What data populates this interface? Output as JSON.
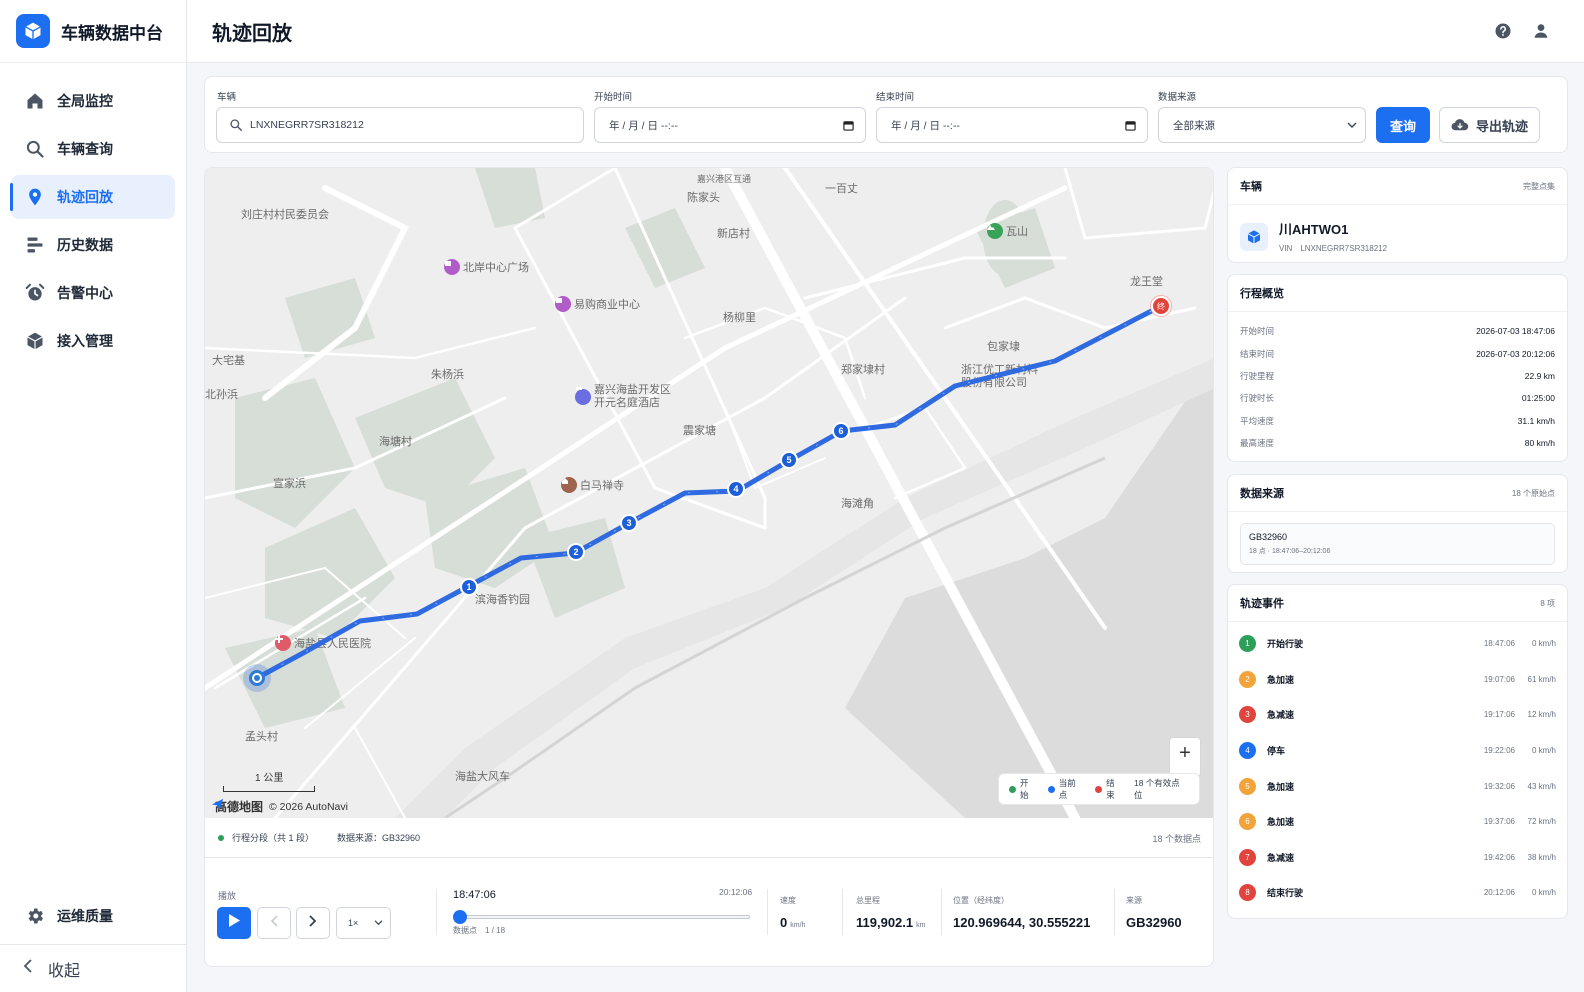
{
  "app": {
    "title": "车辆数据中台"
  },
  "colors": {
    "accent": "#1d6ff2",
    "start": "#2e9e5b",
    "end": "#e0443c",
    "orange": "#f2a33a"
  },
  "sidebar": {
    "items": [
      {
        "label": "全局监控",
        "icon": "home-icon",
        "active": false
      },
      {
        "label": "车辆查询",
        "icon": "search-icon",
        "active": false
      },
      {
        "label": "轨迹回放",
        "icon": "location-pin-icon",
        "active": true
      },
      {
        "label": "历史数据",
        "icon": "bars-icon",
        "active": false
      },
      {
        "label": "告警中心",
        "icon": "alarm-clock-icon",
        "active": false
      },
      {
        "label": "接入管理",
        "icon": "cube-icon",
        "active": false
      }
    ],
    "bottom_item": {
      "label": "运维质量",
      "icon": "gear-icon"
    },
    "collapse_label": "收起"
  },
  "header": {
    "title": "轨迹回放"
  },
  "filters": {
    "vehicle_label": "车辆",
    "vehicle_value": "LNXNEGRR7SR318212",
    "start_label": "开始时间",
    "start_placeholder": "年 / 月 / 日  --:--",
    "end_label": "结束时间",
    "end_placeholder": "年 / 月 / 日  --:--",
    "source_label": "数据来源",
    "source_value": "全部来源",
    "query_label": "查询",
    "export_label": "导出轨迹"
  },
  "map": {
    "labels": [
      "刘庄村村民委员会",
      "陈家头",
      "嘉兴港区互通",
      "一百丈",
      "新店村",
      "大宅基",
      "北孙浜",
      "朱杨浜",
      "杨柳里",
      "郑家埭村",
      "包家埭",
      "龙王堂",
      "海塘村",
      "宣家浜",
      "震家塘",
      "海滩角",
      "滨海香钓园",
      "孟头村",
      "海盐大风车"
    ],
    "pois": [
      {
        "name": "北岸中心广场",
        "color": "#b15dc9"
      },
      {
        "name": "易购商业中心",
        "color": "#b15dc9"
      },
      {
        "name": "嘉兴海盐开发区\n开元名庭酒店",
        "color": "#6a6ee0"
      },
      {
        "name": "白马禅寺",
        "color": "#a0634d"
      },
      {
        "name": "瓦山",
        "color": "#3aa35a"
      },
      {
        "name": "海盐县人民医院",
        "color": "#e05b6a"
      },
      {
        "name": "浙江优工新材料\n股份有限公司",
        "color": "#888888"
      }
    ],
    "markers": [
      "1",
      "2",
      "3",
      "4",
      "5",
      "6"
    ],
    "end_marker": "终",
    "scale_label": "1 公里",
    "attribution_logo": "高德地图",
    "attribution": "© 2026 AutoNavi",
    "zoom_in": "+",
    "legend": {
      "start": "开始",
      "current": "当前点",
      "end": "结束",
      "count": "18 个有效点位"
    }
  },
  "segment": {
    "label": "行程分段（共 1 段）",
    "source": "数据来源：GB32960",
    "count": "18 个数据点"
  },
  "playback": {
    "label": "播放",
    "speed": "1×",
    "current_time": "18:47:06",
    "end_time": "20:12:06",
    "point_label": "数据点　1 / 18",
    "progress": 0,
    "stats": [
      {
        "label": "速度",
        "value": "0",
        "unit": "km/h"
      },
      {
        "label": "总里程",
        "value": "119,902.1",
        "unit": "km"
      },
      {
        "label": "位置（经纬度）",
        "value": "120.969644, 30.555221",
        "unit": ""
      },
      {
        "label": "来源",
        "value": "GB32960",
        "unit": ""
      }
    ]
  },
  "vehicle_card": {
    "title": "车辆",
    "aside": "完整点集",
    "plate": "川AHTWO1",
    "vin": "VIN　LNXNEGRR7SR318212"
  },
  "trip_card": {
    "title": "行程概览",
    "rows": [
      {
        "k": "开始时间",
        "v": "2026-07-03 18:47:06"
      },
      {
        "k": "结束时间",
        "v": "2026-07-03 20:12:06"
      },
      {
        "k": "行驶里程",
        "v": "22.9 km"
      },
      {
        "k": "行驶时长",
        "v": "01:25:00"
      },
      {
        "k": "平均速度",
        "v": "31.1 km/h"
      },
      {
        "k": "最高速度",
        "v": "80 km/h"
      }
    ]
  },
  "source_card": {
    "title": "数据来源",
    "aside": "18 个原始点",
    "name": "GB32960",
    "meta": "18 点 · 18:47:06–20:12:06"
  },
  "events_card": {
    "title": "轨迹事件",
    "aside": "8 项",
    "items": [
      {
        "n": "1",
        "label": "开始行驶",
        "time": "18:47:06",
        "speed": "0 km/h",
        "color": "#2e9e5b"
      },
      {
        "n": "2",
        "label": "急加速",
        "time": "19:07:06",
        "speed": "61 km/h",
        "color": "#f2a33a"
      },
      {
        "n": "3",
        "label": "急减速",
        "time": "19:17:06",
        "speed": "12 km/h",
        "color": "#e0443c"
      },
      {
        "n": "4",
        "label": "停车",
        "time": "19:22:06",
        "speed": "0 km/h",
        "color": "#1d6ff2"
      },
      {
        "n": "5",
        "label": "急加速",
        "time": "19:32:06",
        "speed": "43 km/h",
        "color": "#f2a33a"
      },
      {
        "n": "6",
        "label": "急加速",
        "time": "19:37:06",
        "speed": "72 km/h",
        "color": "#f2a33a"
      },
      {
        "n": "7",
        "label": "急减速",
        "time": "19:42:06",
        "speed": "38 km/h",
        "color": "#e0443c"
      },
      {
        "n": "8",
        "label": "结束行驶",
        "time": "20:12:06",
        "speed": "0 km/h",
        "color": "#e0443c"
      }
    ]
  }
}
